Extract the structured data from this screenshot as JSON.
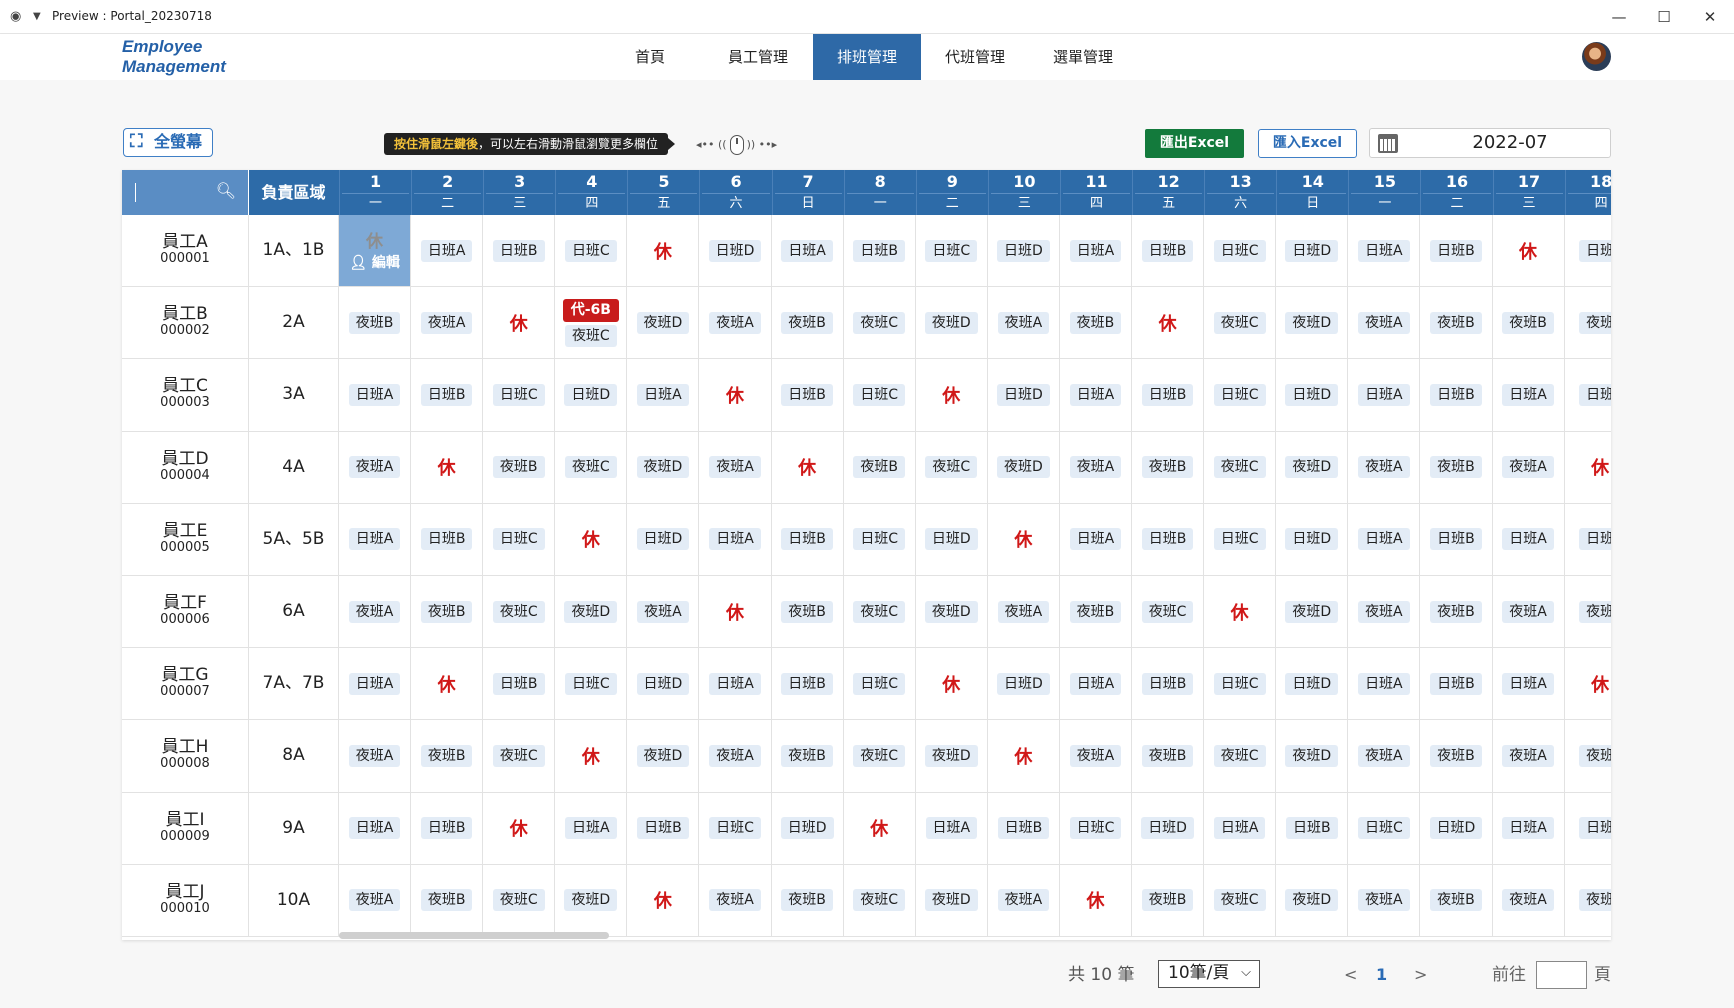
{
  "window": {
    "title": "Preview : Portal_20230718"
  },
  "nav": {
    "logo_line1": "Employee",
    "logo_line2": "Management",
    "items": [
      "首頁",
      "員工管理",
      "排班管理",
      "代班管理",
      "選單管理"
    ],
    "active": "排班管理"
  },
  "toolbar": {
    "fullscreen_label": "全螢幕",
    "hint_highlight": "按住滑鼠左鍵後",
    "hint_rest": "，可以左右滑動滑鼠瀏覽更多欄位",
    "export_label": "匯出Excel",
    "import_label": "匯入Excel",
    "date_value": "2022-07"
  },
  "table": {
    "area_header": "負責區域",
    "days": [
      {
        "n": "1",
        "w": "一"
      },
      {
        "n": "2",
        "w": "二"
      },
      {
        "n": "3",
        "w": "三"
      },
      {
        "n": "4",
        "w": "四"
      },
      {
        "n": "5",
        "w": "五"
      },
      {
        "n": "6",
        "w": "六"
      },
      {
        "n": "7",
        "w": "日"
      },
      {
        "n": "8",
        "w": "一"
      },
      {
        "n": "9",
        "w": "二"
      },
      {
        "n": "10",
        "w": "三"
      },
      {
        "n": "11",
        "w": "四"
      },
      {
        "n": "12",
        "w": "五"
      },
      {
        "n": "13",
        "w": "六"
      },
      {
        "n": "14",
        "w": "日"
      },
      {
        "n": "15",
        "w": "一"
      },
      {
        "n": "16",
        "w": "二"
      },
      {
        "n": "17",
        "w": "三"
      },
      {
        "n": "18",
        "w": "四"
      }
    ],
    "edit_label": "編輯",
    "off_label": "休",
    "rows": [
      {
        "name": "員工A",
        "id": "000001",
        "area": "1A、1B",
        "shifts": [
          "休",
          "日班A",
          "日班B",
          "日班C",
          "休",
          "日班D",
          "日班A",
          "日班B",
          "日班C",
          "日班D",
          "日班A",
          "日班B",
          "日班C",
          "日班D",
          "日班A",
          "日班B",
          "休",
          "日班"
        ]
      },
      {
        "name": "員工B",
        "id": "000002",
        "area": "2A",
        "shifts": [
          "夜班B",
          "夜班A",
          "休",
          "夜班C",
          "夜班D",
          "夜班A",
          "夜班B",
          "夜班C",
          "夜班D",
          "夜班A",
          "夜班B",
          "休",
          "夜班C",
          "夜班D",
          "夜班A",
          "夜班B",
          "夜班B",
          "夜班"
        ]
      },
      {
        "name": "員工C",
        "id": "000003",
        "area": "3A",
        "shifts": [
          "日班A",
          "日班B",
          "日班C",
          "日班D",
          "日班A",
          "休",
          "日班B",
          "日班C",
          "休",
          "日班D",
          "日班A",
          "日班B",
          "日班C",
          "日班D",
          "日班A",
          "日班B",
          "日班A",
          "日班"
        ]
      },
      {
        "name": "員工D",
        "id": "000004",
        "area": "4A",
        "shifts": [
          "夜班A",
          "休",
          "夜班B",
          "夜班C",
          "夜班D",
          "夜班A",
          "休",
          "夜班B",
          "夜班C",
          "夜班D",
          "夜班A",
          "夜班B",
          "夜班C",
          "夜班D",
          "夜班A",
          "夜班B",
          "夜班A",
          "休"
        ]
      },
      {
        "name": "員工E",
        "id": "000005",
        "area": "5A、5B",
        "shifts": [
          "日班A",
          "日班B",
          "日班C",
          "休",
          "日班D",
          "日班A",
          "日班B",
          "日班C",
          "日班D",
          "休",
          "日班A",
          "日班B",
          "日班C",
          "日班D",
          "日班A",
          "日班B",
          "日班A",
          "日班"
        ]
      },
      {
        "name": "員工F",
        "id": "000006",
        "area": "6A",
        "shifts": [
          "夜班A",
          "夜班B",
          "夜班C",
          "夜班D",
          "夜班A",
          "休",
          "夜班B",
          "夜班C",
          "夜班D",
          "夜班A",
          "夜班B",
          "夜班C",
          "休",
          "夜班D",
          "夜班A",
          "夜班B",
          "夜班A",
          "夜班"
        ]
      },
      {
        "name": "員工G",
        "id": "000007",
        "area": "7A、7B",
        "shifts": [
          "日班A",
          "休",
          "日班B",
          "日班C",
          "日班D",
          "日班A",
          "日班B",
          "日班C",
          "休",
          "日班D",
          "日班A",
          "日班B",
          "日班C",
          "日班D",
          "日班A",
          "日班B",
          "日班A",
          "休"
        ]
      },
      {
        "name": "員工H",
        "id": "000008",
        "area": "8A",
        "shifts": [
          "夜班A",
          "夜班B",
          "夜班C",
          "休",
          "夜班D",
          "夜班A",
          "夜班B",
          "夜班C",
          "夜班D",
          "休",
          "夜班A",
          "夜班B",
          "夜班C",
          "夜班D",
          "夜班A",
          "夜班B",
          "夜班A",
          "夜班"
        ]
      },
      {
        "name": "員工I",
        "id": "000009",
        "area": "9A",
        "shifts": [
          "日班A",
          "日班B",
          "休",
          "日班A",
          "日班B",
          "日班C",
          "日班D",
          "休",
          "日班A",
          "日班B",
          "日班C",
          "日班D",
          "日班A",
          "日班B",
          "日班C",
          "日班D",
          "日班A",
          "日班"
        ]
      },
      {
        "name": "員工J",
        "id": "000010",
        "area": "10A",
        "shifts": [
          "夜班A",
          "夜班B",
          "夜班C",
          "夜班D",
          "休",
          "夜班A",
          "夜班B",
          "夜班C",
          "夜班D",
          "夜班A",
          "休",
          "夜班B",
          "夜班C",
          "夜班D",
          "夜班A",
          "夜班B",
          "夜班A",
          "夜班"
        ]
      }
    ],
    "substitution": {
      "row": 1,
      "day": 3,
      "label": "代-6B"
    },
    "selected": {
      "row": 0,
      "day": 0
    }
  },
  "pager": {
    "total": "共 10 筆",
    "page_size": "10筆/頁",
    "prev": "<",
    "current": "1",
    "next": ">",
    "goto_label": "前往",
    "goto_suffix": "頁"
  }
}
